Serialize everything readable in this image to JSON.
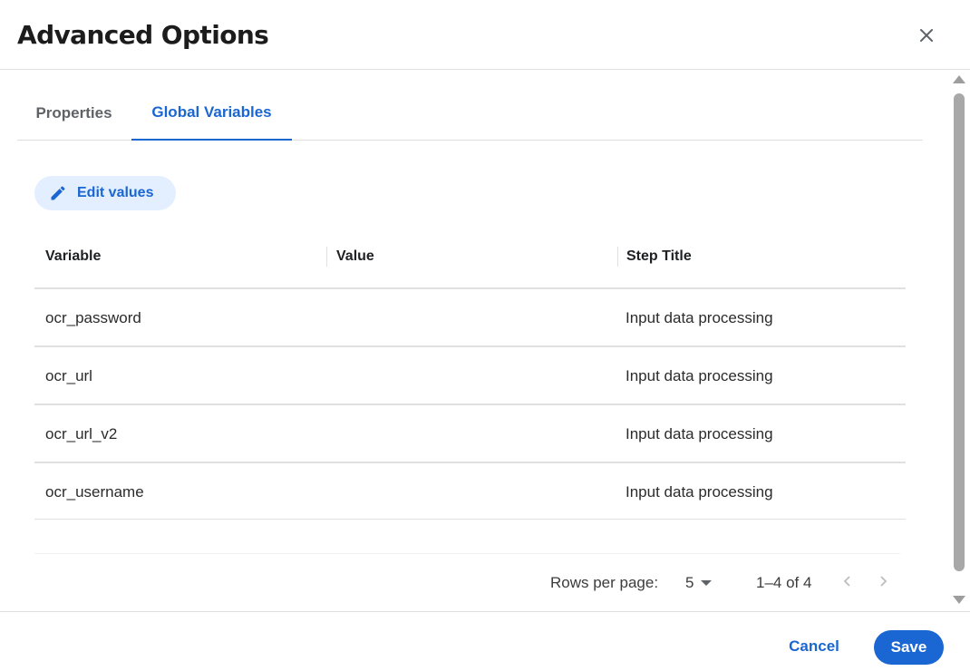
{
  "dialog": {
    "title": "Advanced Options",
    "close_icon": "close-icon"
  },
  "tabs": [
    {
      "label": "Properties",
      "active": false
    },
    {
      "label": "Global Variables",
      "active": true
    }
  ],
  "toolbar": {
    "edit_label": "Edit values",
    "edit_icon": "pencil-icon"
  },
  "table": {
    "columns": [
      "Variable",
      "Value",
      "Step Title"
    ],
    "rows": [
      {
        "variable": "ocr_password",
        "value": "",
        "step_title": "Input data processing"
      },
      {
        "variable": "ocr_url",
        "value": "",
        "step_title": "Input data processing"
      },
      {
        "variable": "ocr_url_v2",
        "value": "",
        "step_title": "Input data processing"
      },
      {
        "variable": "ocr_username",
        "value": "",
        "step_title": "Input data processing"
      }
    ]
  },
  "pagination": {
    "rows_per_page_label": "Rows per page:",
    "rows_per_page_value": "5",
    "range": "1–4 of 4",
    "prev_icon": "chevron-left-icon",
    "next_icon": "chevron-right-icon"
  },
  "footer": {
    "cancel_label": "Cancel",
    "save_label": "Save"
  },
  "colors": {
    "accent": "#1a66d2",
    "accent_light": "#e3efff",
    "divider": "#e0e0e0"
  }
}
